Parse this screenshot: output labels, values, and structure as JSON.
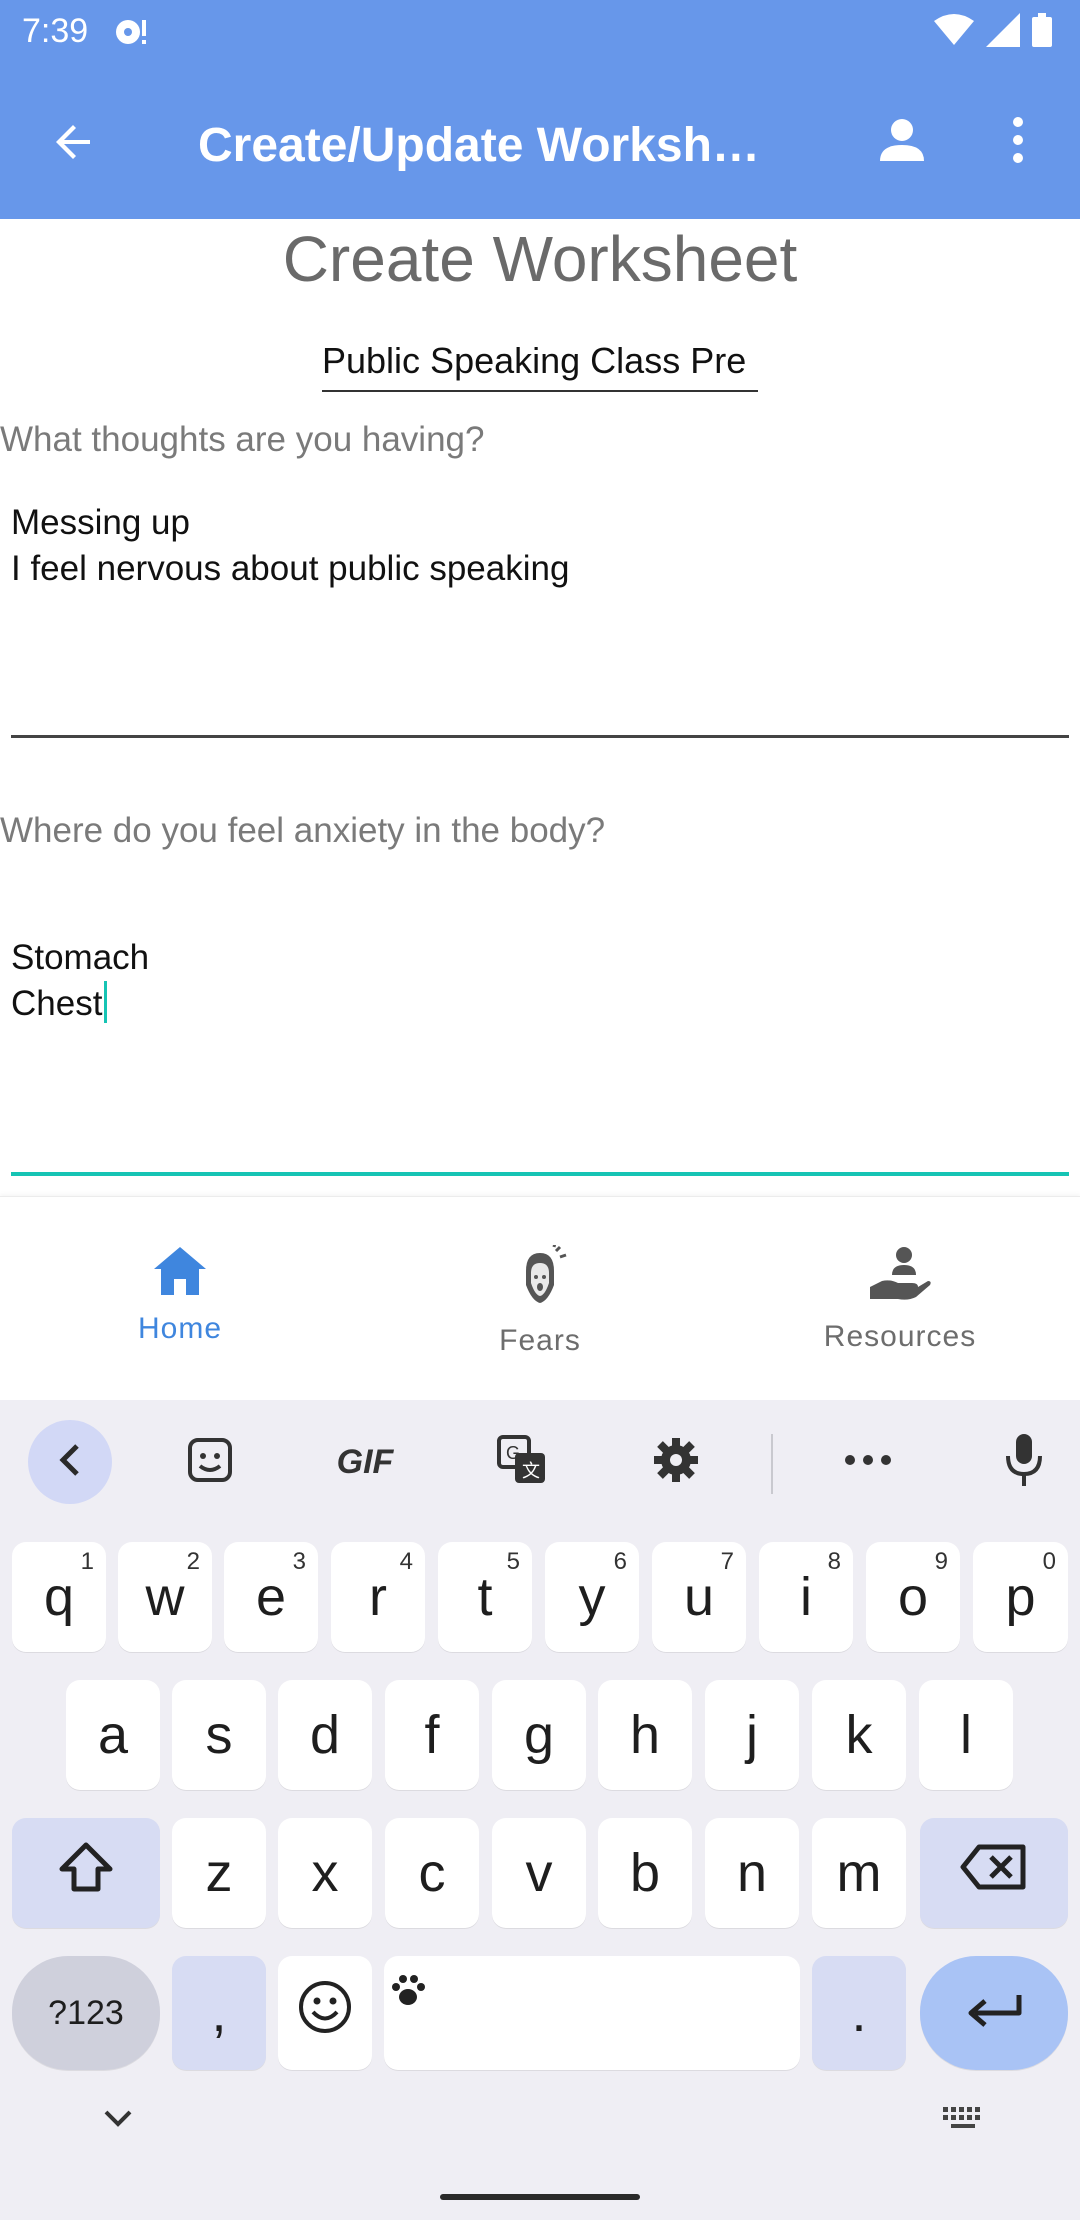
{
  "status_bar": {
    "time": "7:39",
    "icons": [
      "notification-icon",
      "wifi-icon",
      "signal-icon",
      "battery-icon"
    ]
  },
  "app_bar": {
    "title": "Create/Update Worksh…",
    "icons": [
      "back-arrow-icon",
      "profile-icon",
      "more-vert-icon"
    ],
    "background": "#6797ea"
  },
  "form": {
    "heading": "Create Worksheet",
    "worksheet_name": "Public Speaking Class Pre",
    "questions": [
      {
        "label": "What thoughts are you having?",
        "answer_lines": [
          "Messing up",
          "I feel nervous about public speaking"
        ]
      },
      {
        "label": "Where do you feel anxiety in the body?",
        "answer_lines": [
          "Stomach",
          "Chest"
        ]
      }
    ],
    "focus_color": "#16c4b4"
  },
  "bottom_nav": {
    "items": [
      {
        "label": "Home",
        "icon": "home-icon",
        "active": true
      },
      {
        "label": "Fears",
        "icon": "fears-face-icon",
        "active": false
      },
      {
        "label": "Resources",
        "icon": "hand-with-person-icon",
        "active": false
      }
    ],
    "active_color": "#3f86de"
  },
  "keyboard": {
    "toolbar": [
      "collapse-arrow-icon",
      "sticker-icon",
      "GIF",
      "translate-icon",
      "settings-icon",
      "more-horiz-icon",
      "mic-icon"
    ],
    "gif_label": "GIF",
    "row1": [
      {
        "k": "q",
        "h": "1"
      },
      {
        "k": "w",
        "h": "2"
      },
      {
        "k": "e",
        "h": "3"
      },
      {
        "k": "r",
        "h": "4"
      },
      {
        "k": "t",
        "h": "5"
      },
      {
        "k": "y",
        "h": "6"
      },
      {
        "k": "u",
        "h": "7"
      },
      {
        "k": "i",
        "h": "8"
      },
      {
        "k": "o",
        "h": "9"
      },
      {
        "k": "p",
        "h": "0"
      }
    ],
    "row2": [
      "a",
      "s",
      "d",
      "f",
      "g",
      "h",
      "j",
      "k",
      "l"
    ],
    "row3": [
      "z",
      "x",
      "c",
      "v",
      "b",
      "n",
      "m"
    ],
    "row4": {
      "symbols": "?123",
      "comma": ",",
      "period": "."
    }
  }
}
